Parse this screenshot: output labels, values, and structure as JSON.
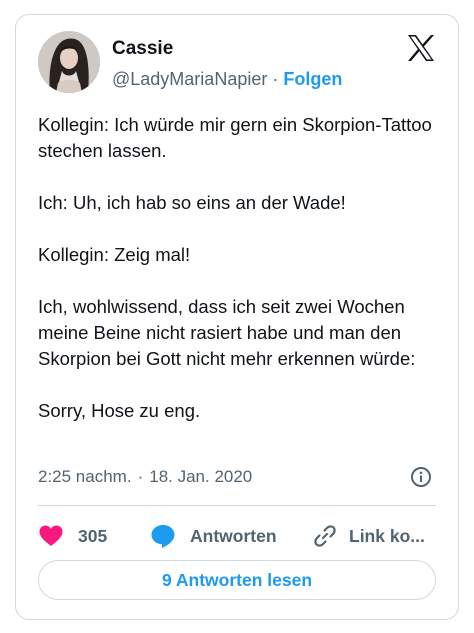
{
  "author": {
    "name": "Cassie",
    "handle": "@LadyMariaNapier",
    "separator": "·",
    "follow_label": "Folgen"
  },
  "tweet": {
    "paragraphs": [
      "Kollegin: Ich würde mir gern ein Skorpion-Tattoo stechen lassen.",
      "Ich: Uh, ich hab so eins an der Wade!",
      "Kollegin: Zeig mal!",
      "Ich, wohlwissend, dass ich seit zwei Wochen meine Beine nicht rasiert habe und man den Skorpion bei Gott nicht mehr erkennen würde:",
      "Sorry, Hose zu eng."
    ],
    "time": "2:25 nachm.",
    "separator": "·",
    "date": "18. Jan. 2020"
  },
  "actions": {
    "like_count": "305",
    "reply_label": "Antworten",
    "link_label": "Link ko..."
  },
  "read_replies_label": "9 Antworten lesen",
  "icons": {
    "logo": "x-logo-icon",
    "info": "info-icon",
    "like": "heart-icon",
    "reply": "speech-bubble-icon",
    "link": "link-icon"
  },
  "colors": {
    "accent": "#1d9bf0",
    "like": "#f91880",
    "text": "#0f1419",
    "muted": "#536471",
    "border": "#cfd9de"
  }
}
